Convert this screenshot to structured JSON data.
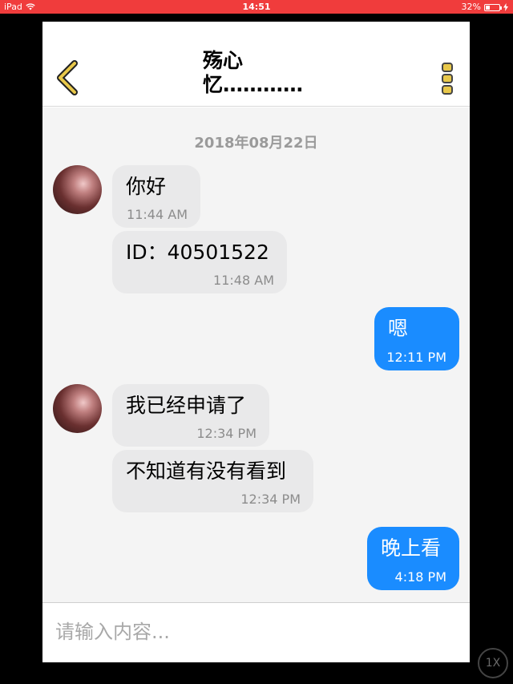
{
  "status_bar": {
    "device": "iPad",
    "time": "14:51",
    "battery": "32%",
    "battery_level": 0.32
  },
  "header": {
    "title": "殇心忆…………"
  },
  "chat": {
    "date": "2018年08月22日",
    "messages": [
      {
        "side": "in",
        "text": "你好",
        "time": "11:44 AM"
      },
      {
        "side": "in",
        "text": "ID：40501522",
        "time": "11:48 AM"
      },
      {
        "side": "out",
        "text": "嗯",
        "time": "12:11 PM"
      },
      {
        "side": "in",
        "text": "我已经申请了",
        "time": "12:34 PM"
      },
      {
        "side": "in",
        "text": "不知道有没有看到",
        "time": "12:34 PM"
      },
      {
        "side": "out",
        "text": "晚上看",
        "time": "4:18 PM"
      }
    ]
  },
  "composer": {
    "placeholder": "请输入内容..."
  },
  "overlay": {
    "speed_label": "1X"
  },
  "colors": {
    "status_bar": "#f03c3c",
    "accent_yellow": "#e8c84a",
    "outgoing_bubble": "#1a8cff",
    "incoming_bubble": "#e9e9ea"
  }
}
